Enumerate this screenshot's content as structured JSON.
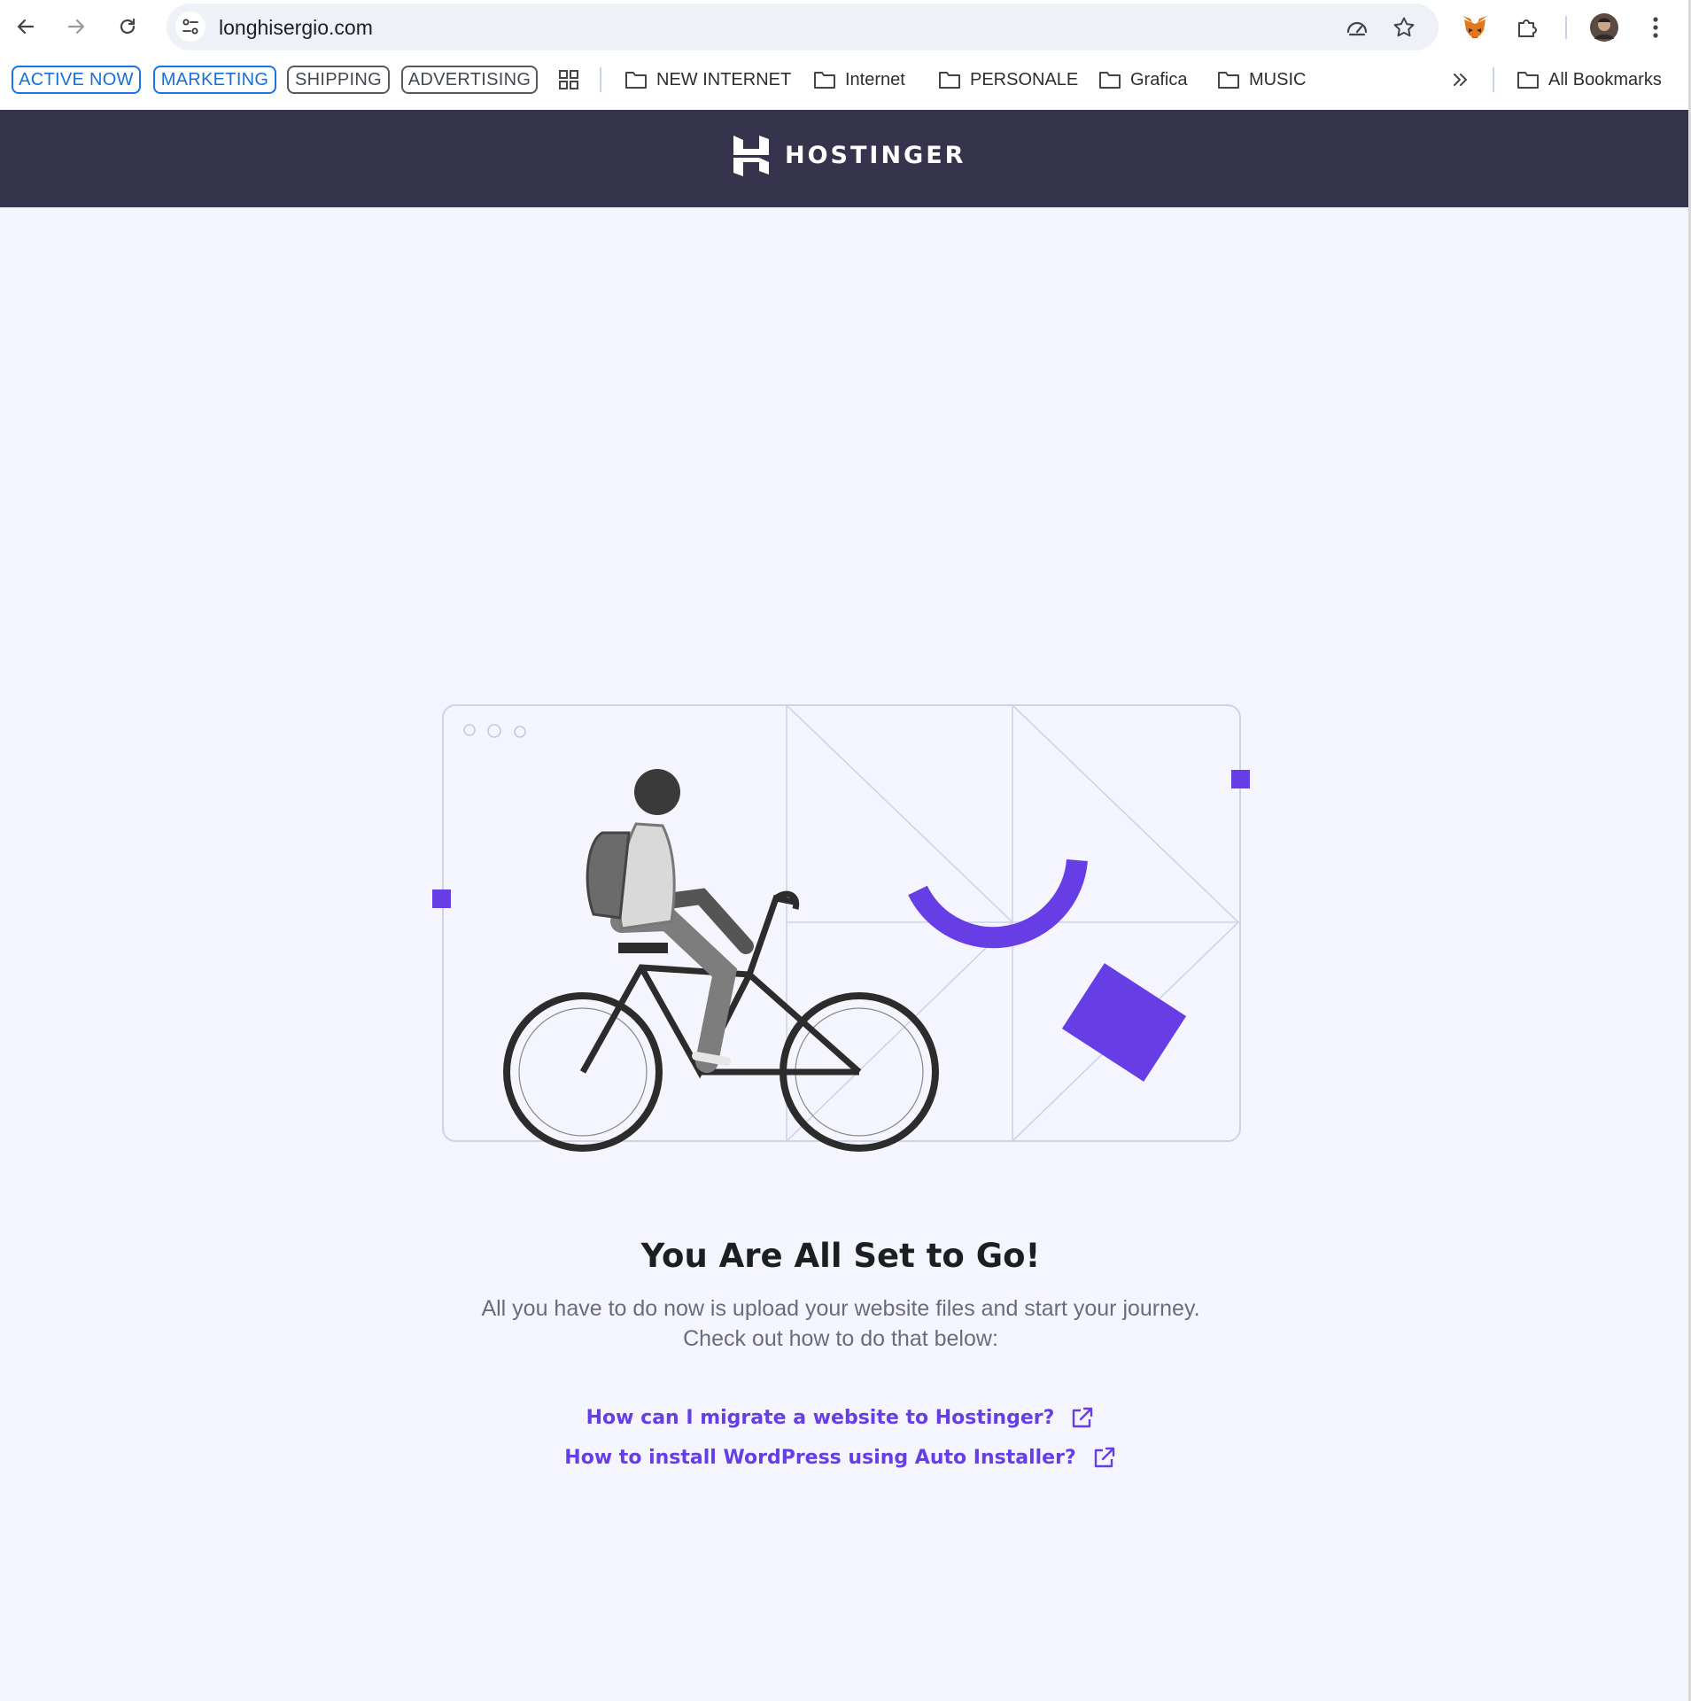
{
  "browser": {
    "url": "longhisergio.com",
    "bookmark_chips": [
      {
        "label": "ACTIVE NOW",
        "style": "blue"
      },
      {
        "label": "MARKETING",
        "style": "blue"
      },
      {
        "label": "SHIPPING",
        "style": "gray"
      },
      {
        "label": "ADVERTISING",
        "style": "gray"
      }
    ],
    "bookmark_folders": [
      "NEW INTERNET",
      "Internet",
      "PERSONALE",
      "Grafica",
      "MUSIC"
    ],
    "all_bookmarks": "All Bookmarks",
    "icons": [
      "back-icon",
      "forward-icon",
      "reload-icon",
      "site-info-icon",
      "performance-icon",
      "star-icon",
      "metamask-fox-icon",
      "extensions-icon",
      "profile-avatar",
      "menu-icon",
      "apps-grid-icon",
      "overflow-chevron-icon",
      "folder-icon"
    ]
  },
  "header": {
    "brand": "HOSTINGER",
    "background_color": "#36344d"
  },
  "main": {
    "title": "You Are All Set to Go!",
    "subtitle_line1": "All you have to do now is upload your website files and start your journey.",
    "subtitle_line2": "Check out how to do that below:",
    "links": [
      {
        "label": "How can I migrate a website to Hostinger?",
        "icon": "external-link-icon"
      },
      {
        "label": "How to install WordPress using Auto Installer?",
        "icon": "external-link-icon"
      }
    ],
    "accent_color": "#673de6",
    "background_color": "#f4f5ff"
  }
}
